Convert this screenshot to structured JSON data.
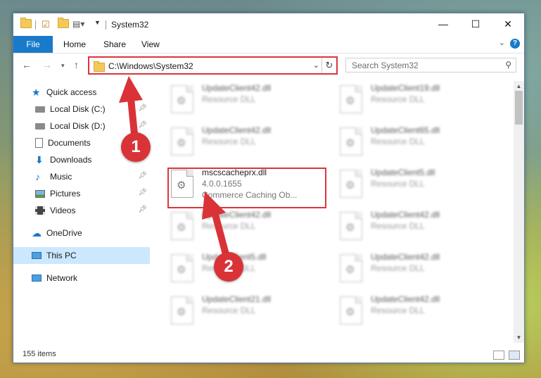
{
  "window": {
    "title": "System32",
    "controls": {
      "minimize": "—",
      "maximize": "☐",
      "close": "✕"
    }
  },
  "ribbon": {
    "tabs": [
      "File",
      "Home",
      "Share",
      "View"
    ]
  },
  "address_bar": {
    "path": "C:\\Windows\\System32"
  },
  "search": {
    "placeholder": "Search System32"
  },
  "nav_pane": {
    "items": [
      {
        "label": "Quick access",
        "icon": "star-icon"
      },
      {
        "label": "Local Disk (C:)",
        "icon": "drive-icon",
        "pinned": true
      },
      {
        "label": "Local Disk (D:)",
        "icon": "drive-icon",
        "pinned": true
      },
      {
        "label": "Documents",
        "icon": "documents-icon",
        "pinned": true
      },
      {
        "label": "Downloads",
        "icon": "downloads-icon",
        "pinned": true
      },
      {
        "label": "Music",
        "icon": "music-icon",
        "pinned": true
      },
      {
        "label": "Pictures",
        "icon": "pictures-icon",
        "pinned": true
      },
      {
        "label": "Videos",
        "icon": "videos-icon",
        "pinned": true
      },
      {
        "label": "OneDrive",
        "icon": "onedrive-icon"
      },
      {
        "label": "This PC",
        "icon": "this-pc-icon",
        "selected": true
      },
      {
        "label": "Network",
        "icon": "network-icon"
      }
    ]
  },
  "files": [
    {
      "name": "UpdateClient42.dll",
      "type": "Resource DLL"
    },
    {
      "name": "UpdateClient19.dll",
      "type": "Resource DLL"
    },
    {
      "name": "UpdateClient42.dll",
      "type": "Resource DLL"
    },
    {
      "name": "UpdateClient65.dll",
      "type": "Resource DLL"
    },
    {
      "name": "mscscacheprx.dll",
      "version": "4.0.0.1655",
      "description": "Commerce Caching Ob...",
      "highlighted": true
    },
    {
      "name": "UpdateClient5.dll",
      "type": "Resource DLL"
    },
    {
      "name": "UpdateClient42.dll",
      "type": "Resource DLL"
    },
    {
      "name": "UpdateClient42.dll",
      "type": "Resource DLL"
    },
    {
      "name": "UpdateClient5.dll",
      "type": "Resource DLL"
    },
    {
      "name": "UpdateClient42.dll",
      "type": "Resource DLL"
    },
    {
      "name": "UpdateClient21.dll",
      "type": "Resource DLL"
    },
    {
      "name": "UpdateClient42.dll",
      "type": "Resource DLL"
    }
  ],
  "status": {
    "item_count": "155 items"
  },
  "annotations": {
    "step1": "1",
    "step2": "2",
    "color": "#d93338"
  },
  "colors": {
    "accent": "#1979ca",
    "selection": "#cce8ff",
    "highlight_border": "#d9363e"
  }
}
